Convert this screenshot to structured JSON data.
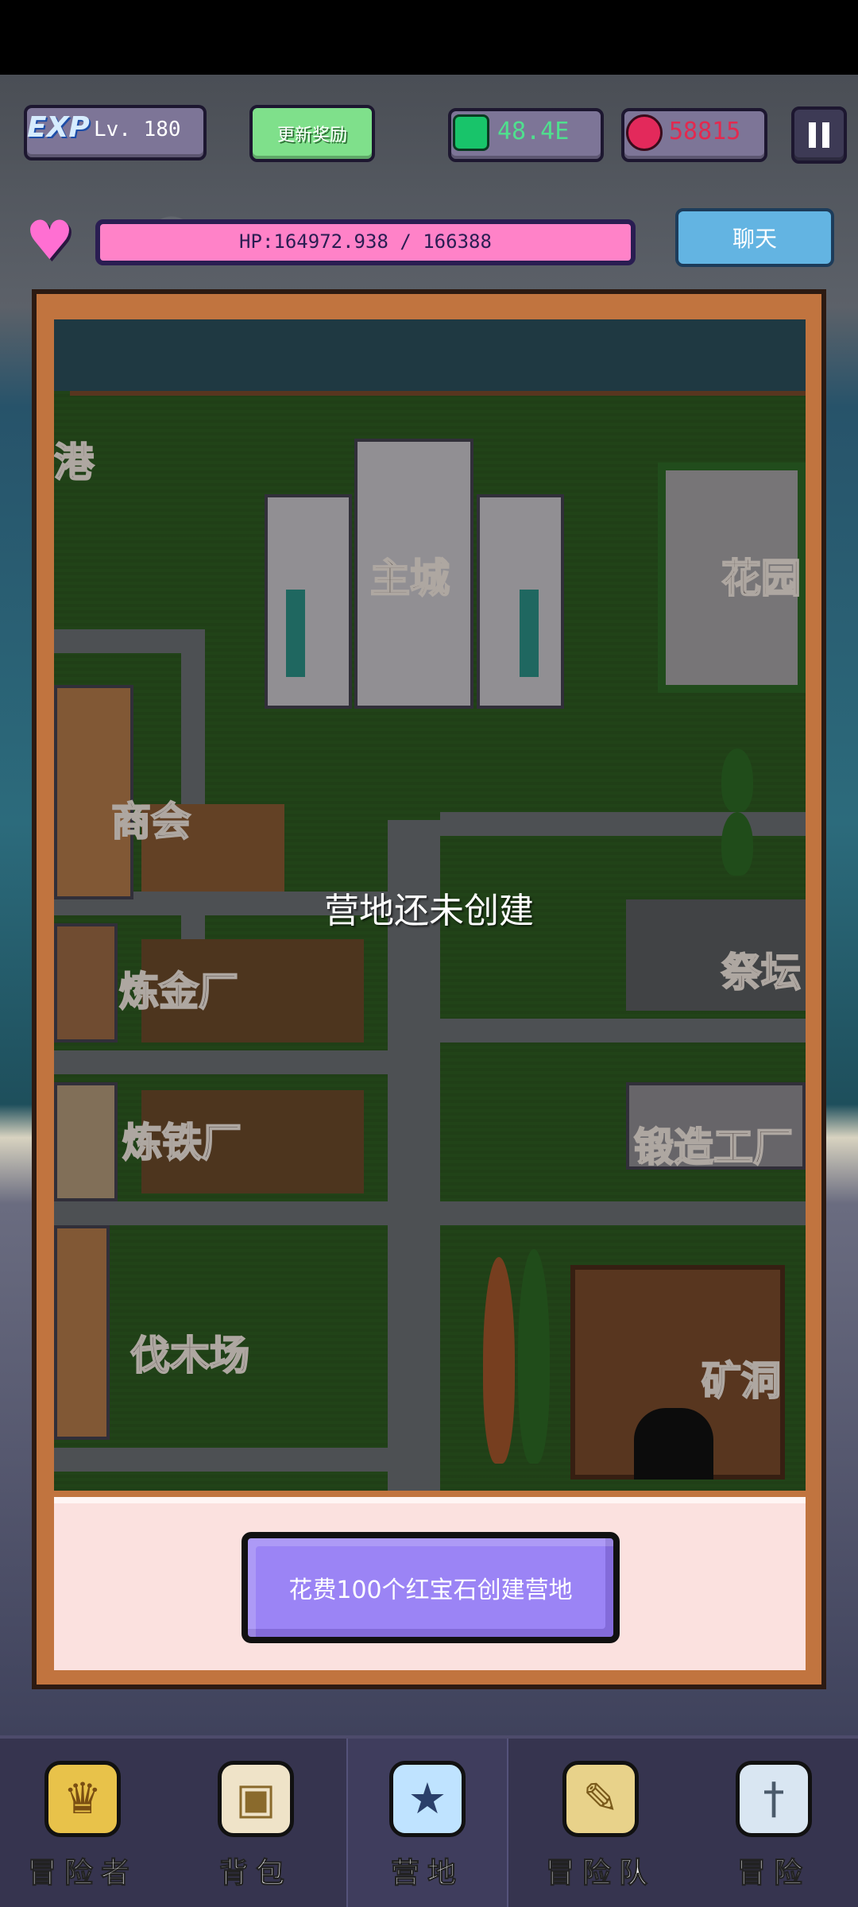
{
  "top_bar": {
    "exp_label": "EXP",
    "level": "Lv. 180",
    "reward_button": "更新奖励",
    "gems": "48.4E",
    "rubies": "58815"
  },
  "hp": {
    "text": "HP:164972.938 / 166388"
  },
  "chat_button": "聊天",
  "map": {
    "labels": {
      "harbor": "港",
      "main_city": "主城",
      "garden": "花园",
      "guild": "商会",
      "altar": "祭坛",
      "alchemy": "炼金厂",
      "iron": "炼铁厂",
      "forge": "锻造工厂",
      "lumber": "伐木场",
      "mine": "矿洞"
    },
    "status": "营地还未创建"
  },
  "create_button": "花费100个红宝石创建营地",
  "nav": [
    {
      "label": "冒险者",
      "icon": "helmet-icon"
    },
    {
      "label": "背包",
      "icon": "backpack-icon"
    },
    {
      "label": "营地",
      "icon": "camp-banner-icon",
      "active": true
    },
    {
      "label": "冒险队",
      "icon": "scroll-book-icon"
    },
    {
      "label": "冒险",
      "icon": "sword-icon"
    }
  ],
  "colors": {
    "gem": "#4fe08e",
    "ruby": "#e3294f",
    "hp": "#ff82c8",
    "button": "#9b84f5",
    "chat": "#63b4e2"
  }
}
